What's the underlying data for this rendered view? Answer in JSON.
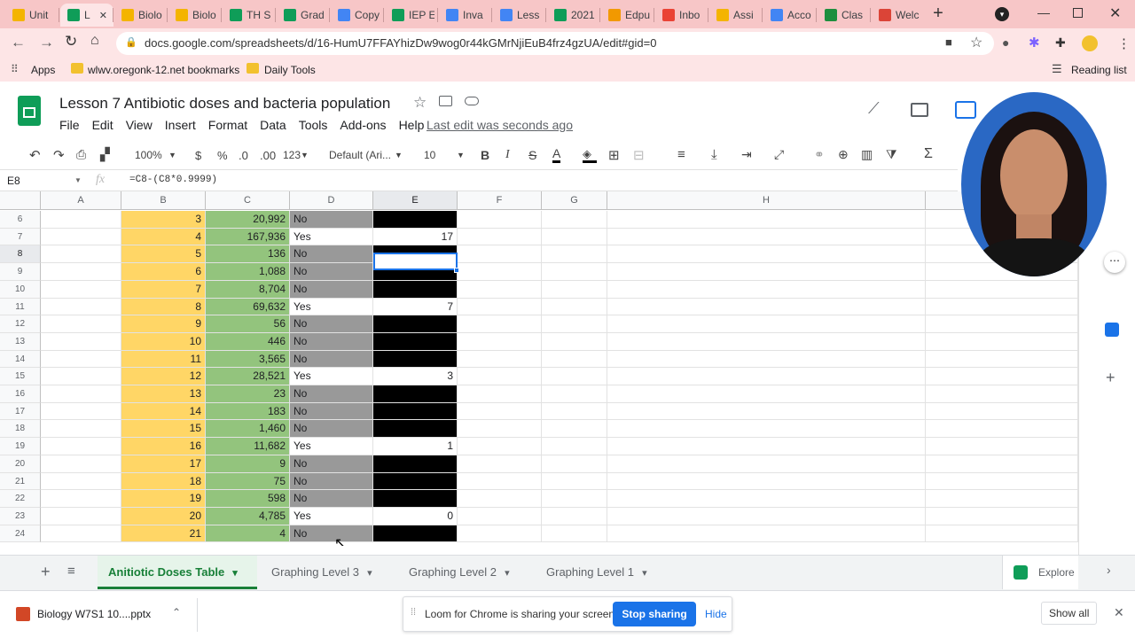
{
  "browser": {
    "tabs": [
      {
        "title": "Unit",
        "favicon": "drive-icon",
        "color": "#f4b400"
      },
      {
        "title": "L",
        "favicon": "sheets-icon",
        "color": "#0f9d58",
        "active": true
      },
      {
        "title": "Biolo",
        "favicon": "slides-icon",
        "color": "#f4b400"
      },
      {
        "title": "Biolo",
        "favicon": "slides-icon",
        "color": "#f4b400"
      },
      {
        "title": "TH S",
        "favicon": "sheets-icon",
        "color": "#0f9d58"
      },
      {
        "title": "Grad",
        "favicon": "sheets-icon",
        "color": "#0f9d58"
      },
      {
        "title": "Copy",
        "favicon": "docs-icon",
        "color": "#4285f4"
      },
      {
        "title": "IEP E",
        "favicon": "sheets-icon",
        "color": "#0f9d58"
      },
      {
        "title": "Inva",
        "favicon": "docs-icon",
        "color": "#4285f4"
      },
      {
        "title": "Less",
        "favicon": "docs-icon",
        "color": "#4285f4"
      },
      {
        "title": "2021",
        "favicon": "sheets-icon",
        "color": "#0f9d58"
      },
      {
        "title": "Edpu",
        "favicon": "edpuzzle-icon",
        "color": "#f29900"
      },
      {
        "title": "Inbo",
        "favicon": "gmail-icon",
        "color": "#ea4335"
      },
      {
        "title": "Assi",
        "favicon": "slides-icon",
        "color": "#f4b400"
      },
      {
        "title": "Acco",
        "favicon": "docs-icon",
        "color": "#4285f4"
      },
      {
        "title": "Clas",
        "favicon": "classroom-icon",
        "color": "#1e8e3e"
      },
      {
        "title": "Welc",
        "favicon": "chrome-icon",
        "color": "#db4437"
      }
    ],
    "url": "docs.google.com/spreadsheets/d/16-HumU7FFAYhizDw9wog0r44kGMrNjiEuB4frz4gzUA/edit#gid=0",
    "bookmarks": [
      {
        "label": "Apps"
      },
      {
        "label": "wlwv.oregonk-12.net bookmarks"
      },
      {
        "label": "Daily Tools"
      }
    ],
    "reading_list": "Reading list"
  },
  "doc": {
    "title": "Lesson 7 Antibiotic doses and bacteria population",
    "menus": [
      "File",
      "Edit",
      "View",
      "Insert",
      "Format",
      "Data",
      "Tools",
      "Add-ons",
      "Help"
    ],
    "last_edit": "Last edit was seconds ago"
  },
  "toolbar": {
    "zoom": "100%",
    "currency": "$",
    "percent": "%",
    "dec_decrease": ".0",
    "dec_increase": ".00",
    "format_more": "123",
    "font": "Default (Ari...",
    "font_size": "10",
    "bold": "B",
    "italic": "I",
    "strike": "S",
    "textcolor": "A"
  },
  "formula_bar": {
    "cell_ref": "E8",
    "fx": "fx",
    "formula": "=C8-(C8*0.9999)"
  },
  "columns": [
    "A",
    "B",
    "C",
    "D",
    "E",
    "F",
    "G",
    "H"
  ],
  "rows": [
    {
      "row": "6",
      "b": "3",
      "c": "20,992",
      "d": "No",
      "e": ""
    },
    {
      "row": "7",
      "b": "4",
      "c": "167,936",
      "d": "Yes",
      "e": "17"
    },
    {
      "row": "8",
      "b": "5",
      "c": "136",
      "d": "No",
      "e": ""
    },
    {
      "row": "9",
      "b": "6",
      "c": "1,088",
      "d": "No",
      "e": ""
    },
    {
      "row": "10",
      "b": "7",
      "c": "8,704",
      "d": "No",
      "e": ""
    },
    {
      "row": "11",
      "b": "8",
      "c": "69,632",
      "d": "Yes",
      "e": "7"
    },
    {
      "row": "12",
      "b": "9",
      "c": "56",
      "d": "No",
      "e": ""
    },
    {
      "row": "13",
      "b": "10",
      "c": "446",
      "d": "No",
      "e": ""
    },
    {
      "row": "14",
      "b": "11",
      "c": "3,565",
      "d": "No",
      "e": ""
    },
    {
      "row": "15",
      "b": "12",
      "c": "28,521",
      "d": "Yes",
      "e": "3"
    },
    {
      "row": "16",
      "b": "13",
      "c": "23",
      "d": "No",
      "e": ""
    },
    {
      "row": "17",
      "b": "14",
      "c": "183",
      "d": "No",
      "e": ""
    },
    {
      "row": "18",
      "b": "15",
      "c": "1,460",
      "d": "No",
      "e": ""
    },
    {
      "row": "19",
      "b": "16",
      "c": "11,682",
      "d": "Yes",
      "e": "1"
    },
    {
      "row": "20",
      "b": "17",
      "c": "9",
      "d": "No",
      "e": ""
    },
    {
      "row": "21",
      "b": "18",
      "c": "75",
      "d": "No",
      "e": ""
    },
    {
      "row": "22",
      "b": "19",
      "c": "598",
      "d": "No",
      "e": ""
    },
    {
      "row": "23",
      "b": "20",
      "c": "4,785",
      "d": "Yes",
      "e": "0"
    },
    {
      "row": "24",
      "b": "21",
      "c": "4",
      "d": "No",
      "e": ""
    }
  ],
  "sheet_tabs": [
    {
      "label": "Anitiotic Doses Table",
      "active": true
    },
    {
      "label": "Graphing Level 3"
    },
    {
      "label": "Graphing Level 2"
    },
    {
      "label": "Graphing Level 1"
    }
  ],
  "explore_label": "Explore",
  "download": {
    "file": "Biology W7S1 10....pptx",
    "show_all": "Show all"
  },
  "loom": {
    "message": "Loom for Chrome is sharing your screen.",
    "stop": "Stop sharing",
    "hide": "Hide"
  },
  "colors": {
    "chrome_tab_bar": "#f7c6c7",
    "chrome_toolbar": "#fde5e6",
    "col_b": "#ffd666",
    "col_c": "#93c47d",
    "col_d_no": "#999999",
    "sheets_green": "#0f9d58",
    "link_blue": "#1a73e8"
  }
}
